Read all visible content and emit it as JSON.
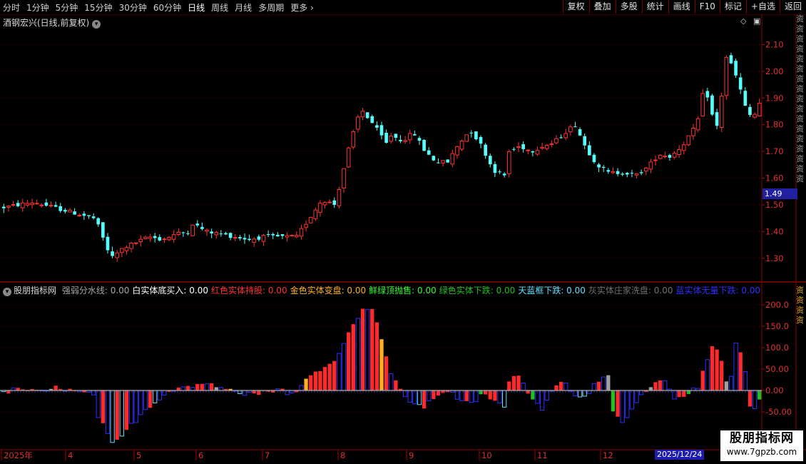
{
  "toolbar": {
    "periods": [
      "分时",
      "1分钟",
      "5分钟",
      "15分钟",
      "30分钟",
      "60分钟",
      "日线",
      "周线",
      "月线",
      "多周期",
      "更多"
    ],
    "active": "日线",
    "right_buttons": [
      "复权",
      "叠加",
      "多股",
      "统计",
      "画线",
      "F10",
      "标记",
      "+自选",
      "返回"
    ]
  },
  "stock": {
    "title": "酒钢宏兴(日线,前复权)",
    "current_price": "1.49"
  },
  "indicator": {
    "name": "股朋指标网",
    "items": [
      {
        "label": "强弱分水线: 0.00",
        "color": "#a8a8a8"
      },
      {
        "label": "白实体底买入: 0.00",
        "color": "#ffffff"
      },
      {
        "label": "红色实体持股: 0.00",
        "color": "#ff3030"
      },
      {
        "label": "金色实体变盘: 0.00",
        "color": "#ffb020"
      },
      {
        "label": "鲜绿顶抛售: 0.00",
        "color": "#30ff30"
      },
      {
        "label": "绿色实体下跌: 0.00",
        "color": "#20c020"
      },
      {
        "label": "天蓝框下跌: 0.00",
        "color": "#60e0ff"
      },
      {
        "label": "灰实体庄家洗盘: 0.00",
        "color": "#707070"
      },
      {
        "label": "蓝实体无量下跌: 0.00",
        "color": "#3030ff"
      }
    ]
  },
  "right_strip_text": "资资资资资资资资资资资资资资资资资",
  "right_strip_text2": "资资资资",
  "watermark": {
    "name": "股朋指标网",
    "url": "www.7gpzb.com"
  },
  "selected_date": "2025/12/24",
  "chart_data": [
    {
      "type": "candlestick",
      "yticks": [
        2.1,
        2.0,
        1.9,
        1.8,
        1.7,
        1.6,
        1.5,
        1.4,
        1.3
      ],
      "ylim": [
        1.23,
        2.16
      ],
      "segments": [
        {
          "n": 20,
          "p": [
            1.49,
            1.51,
            1.48,
            1.45
          ]
        },
        {
          "n": 20,
          "p": [
            1.42,
            1.3,
            1.34,
            1.36,
            1.38,
            1.37,
            1.39,
            1.4
          ]
        },
        {
          "n": 22,
          "p": [
            1.43,
            1.4,
            1.39,
            1.38,
            1.37,
            1.38,
            1.38,
            1.38
          ]
        },
        {
          "n": 20,
          "p": [
            1.38,
            1.45,
            1.52,
            1.5,
            1.7,
            1.86,
            1.8,
            1.73
          ]
        },
        {
          "n": 25,
          "p": [
            1.76,
            1.74,
            1.77,
            1.7,
            1.66,
            1.66,
            1.73,
            1.78,
            1.72,
            1.63,
            1.61
          ]
        },
        {
          "n": 22,
          "p": [
            1.7,
            1.72,
            1.7,
            1.72,
            1.73,
            1.77,
            1.8,
            1.71,
            1.65,
            1.62
          ]
        },
        {
          "n": 18,
          "p": [
            1.62,
            1.62,
            1.61,
            1.64,
            1.69,
            1.68,
            1.72,
            1.78
          ]
        },
        {
          "n": 14,
          "p": [
            1.82,
            1.95,
            1.84,
            1.78,
            2.06,
            2.02,
            1.95,
            1.86,
            1.82,
            1.88
          ]
        }
      ],
      "xticks": [
        "2025年",
        "4",
        "5",
        "6",
        "7",
        "8",
        "9",
        "10",
        "11",
        "12"
      ]
    },
    {
      "type": "bar",
      "yticks": [
        "200.0",
        "150.0",
        "100.0",
        "50.00",
        "0.00",
        "-50.00"
      ],
      "yvals": [
        200,
        150,
        100,
        50,
        0,
        -50
      ],
      "ylim": [
        -135,
        225
      ],
      "segments": [
        {
          "n": 20,
          "p": [
            -5,
            5,
            -5,
            8,
            -3,
            -12
          ]
        },
        {
          "n": 20,
          "p": [
            -60,
            -130,
            -90,
            -50,
            -20,
            5,
            10
          ]
        },
        {
          "n": 22,
          "p": [
            10,
            20,
            5,
            10,
            -5,
            -8,
            -3,
            5,
            -10
          ]
        },
        {
          "n": 20,
          "p": [
            -5,
            30,
            50,
            60,
            100,
            150,
            200,
            180,
            80
          ]
        },
        {
          "n": 25,
          "p": [
            40,
            -10,
            -30,
            -40,
            -10,
            0,
            -20,
            -35,
            -10,
            -20,
            -40
          ]
        },
        {
          "n": 22,
          "p": [
            20,
            40,
            -20,
            -40,
            10,
            20,
            -10,
            -10,
            20,
            30
          ]
        },
        {
          "n": 18,
          "p": [
            -50,
            -80,
            -40,
            -10,
            10,
            30,
            -20,
            -10,
            0
          ]
        },
        {
          "n": 14,
          "p": [
            10,
            60,
            110,
            80,
            0,
            120,
            60,
            -60,
            -20
          ]
        }
      ]
    }
  ]
}
